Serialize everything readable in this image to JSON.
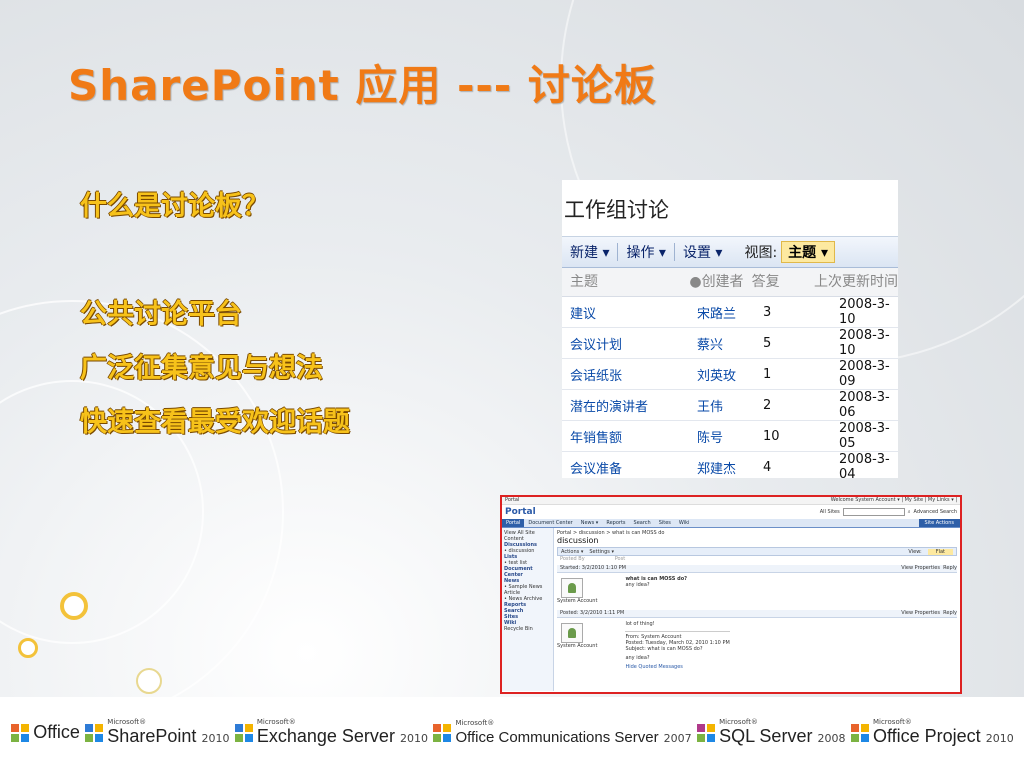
{
  "slide": {
    "title": "SharePoint 应用 --- 讨论板",
    "question": "什么是讨论板？",
    "points": [
      "公共讨论平台",
      "广泛征集意见与想法",
      "快速查看最受欢迎话题"
    ]
  },
  "discussion_panel": {
    "title": "工作组讨论",
    "toolbar": {
      "new": "新建",
      "actions": "操作",
      "settings": "设置",
      "view_label": "视图:",
      "view_value": "主题"
    },
    "columns": [
      "主题",
      "创建者",
      "答复",
      "上次更新时间"
    ],
    "rows": [
      {
        "subject": "建议",
        "creator": "宋路兰",
        "replies": "3",
        "updated": "2008-3-10"
      },
      {
        "subject": "会议计划",
        "creator": "蔡兴",
        "replies": "5",
        "updated": "2008-3-10"
      },
      {
        "subject": "会话纸张",
        "creator": "刘英玫",
        "replies": "1",
        "updated": "2008-3-09"
      },
      {
        "subject": "潜在的演讲者",
        "creator": "王伟",
        "replies": "2",
        "updated": "2008-3-06"
      },
      {
        "subject": "年销售额",
        "creator": "陈号",
        "replies": "10",
        "updated": "2008-3-05"
      },
      {
        "subject": "会议准备",
        "creator": "郑建杰",
        "replies": "4",
        "updated": "2008-3-04"
      }
    ]
  },
  "portal": {
    "topbar_left": "Portal",
    "topbar_right": "Welcome System Account ▾ | My Site | My Links ▾ |",
    "logo": "Portal",
    "search_scope": "All Sites",
    "advanced_search": "Advanced Search",
    "site_actions": "Site Actions",
    "tabs": [
      "Portal",
      "Document Center",
      "News ▾",
      "Reports",
      "Search",
      "Sites",
      "Wiki"
    ],
    "breadcrumb": "Portal > discussion > what is can MOSS do",
    "page_title": "discussion",
    "actions": "Actions ▾",
    "settings": "Settings ▾",
    "view_label": "View:",
    "view_value": "Flat",
    "left_nav": [
      "View All Site Content",
      "Discussions",
      "• discussion",
      "Lists",
      "• test list",
      "Document Center",
      "News",
      "• Sample News Article",
      "• News Archive",
      "Reports",
      "Search",
      "Sites",
      "Wiki",
      "Recycle Bin"
    ],
    "posted_by": "Posted By",
    "post_col": "Post",
    "posts": [
      {
        "started": "Started: 3/2/2010 1:10 PM",
        "author": "System Account",
        "subject": "what is can MOSS do?",
        "body": "any idea?",
        "view_properties": "View Properties",
        "reply": "Reply"
      },
      {
        "started": "Posted: 3/2/2010 1:11 PM",
        "author": "System Account",
        "subject": "lot of thing!",
        "quote_from": "From: System Account",
        "quote_posted": "Posted: Tuesday, March 02, 2010 1:10 PM",
        "quote_subject": "Subject: what is can MOSS do?",
        "quote_body": "any idea?",
        "hide_quoted": "Hide Quoted Messages",
        "view_properties": "View Properties",
        "reply": "Reply"
      }
    ]
  },
  "logos": [
    {
      "ms": "",
      "name": "Office",
      "version": ""
    },
    {
      "ms": "Microsoft®",
      "name": "SharePoint",
      "version": "2010"
    },
    {
      "ms": "Microsoft®",
      "name": "Exchange Server",
      "version": "2010"
    },
    {
      "ms": "Microsoft®",
      "name": "Office Communications Server",
      "version": "2007"
    },
    {
      "ms": "Microsoft®",
      "name": "SQL Server",
      "version": "2008"
    },
    {
      "ms": "Microsoft®",
      "name": "Office Project",
      "version": "2010"
    }
  ],
  "colors": {
    "title": "#f07a16",
    "bullets": "#f7c21a",
    "link": "#0a4aa8",
    "frame": "#d22222"
  }
}
